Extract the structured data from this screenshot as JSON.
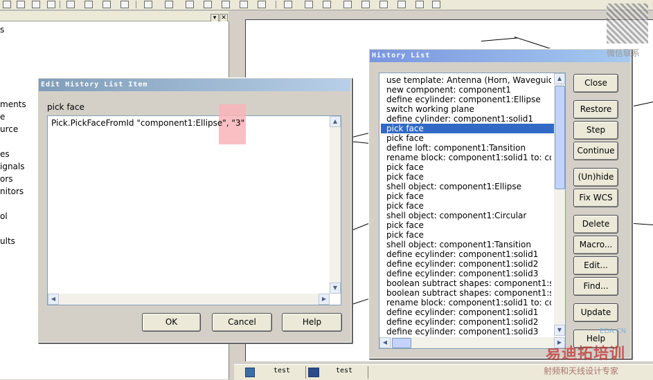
{
  "tree": {
    "items": [
      "s",
      "ments",
      "e",
      "urce",
      "es",
      "ignals",
      "ors",
      "nitors",
      "ol",
      "ults"
    ]
  },
  "status": {
    "tabs": [
      "test",
      "test"
    ]
  },
  "edit_dialog": {
    "title": "Edit History List Item",
    "label": "pick face",
    "command_text": "Pick.PickFaceFromId \"component1:Ellipse\", \"3\"",
    "ok_label": "OK",
    "cancel_label": "Cancel",
    "help_label": "Help"
  },
  "history_dialog": {
    "title": "History List",
    "selected_index": 5,
    "items": [
      "use template: Antenna (Horn, Waveguide",
      "new component: component1",
      "define ecylinder: component1:Ellipse",
      "switch working plane",
      "define cylinder: component1:solid1",
      "pick face",
      "pick face",
      "define loft: component1:Tansition",
      "rename block: component1:solid1 to: com",
      "pick face",
      "pick face",
      "shell object: component1:Ellipse",
      "pick face",
      "pick face",
      "shell object: component1:Circular",
      "pick face",
      "pick face",
      "shell object: component1:Tansition",
      "define ecylinder: component1:solid1",
      "define ecylinder: component1:solid2",
      "define ecylinder: component1:solid3",
      "boolean subtract shapes: component1:so",
      "boolean subtract shapes: component1:so",
      "rename block: component1:solid1 to: com",
      "define ecylinder: component1:solid1",
      "define ecylinder: component1:solid2",
      "define ecylinder: component1:solid3"
    ],
    "buttons": {
      "close": "Close",
      "restore": "Restore",
      "step": "Step",
      "continue": "Continue",
      "unhide": "(Un)hide",
      "fix_wcs": "Fix WCS",
      "delete": "Delete",
      "macro": "Macro...",
      "edit": "Edit...",
      "find": "Find...",
      "update": "Update",
      "help": "Help"
    }
  },
  "watermark": {
    "top_right": "微信联系",
    "bottom_brand": "易迪拓培训",
    "bottom_sub": "射频和天线设计专家",
    "site": "EDA.CN"
  },
  "colors": {
    "title_active": "#7a96df",
    "selection": "#316ac5",
    "highlight_marker": "#f8b4b8"
  }
}
